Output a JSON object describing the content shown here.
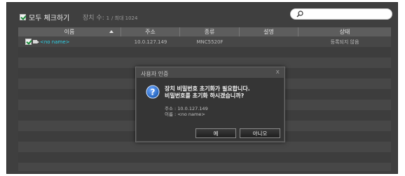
{
  "header": {
    "select_all_label": "모두 체크하기",
    "device_count_label": "장치 수:",
    "device_count_value": "1",
    "device_max_label": "/ 최대 1024",
    "search_placeholder": ""
  },
  "table": {
    "columns": [
      "이름",
      "주소",
      "종류",
      "설명",
      "상태"
    ],
    "rows": [
      {
        "checked": true,
        "name": "<no name>",
        "address": "10.0.127.149",
        "type": "MNC5520F",
        "description": "",
        "status": "등록되지 않음"
      }
    ]
  },
  "dialog": {
    "title": "사용자 인증",
    "close": "x",
    "message_line1": "장치 비밀번호 초기화가 필요합니다.",
    "message_line2": "비밀번호를 초기화 하시겠습니까?",
    "address_line": "주소 : 10.0.127.149",
    "name_line": "이름 : <no name>",
    "yes_label": "예",
    "no_label": "아니오"
  },
  "colors": {
    "accent_name": "#2ed3e8",
    "check_green": "#1a8a3a",
    "question_blue": "#1e5fb8"
  },
  "icons": [
    "check-icon",
    "search-icon",
    "sort-up-icon",
    "camera-icon",
    "question-icon"
  ]
}
